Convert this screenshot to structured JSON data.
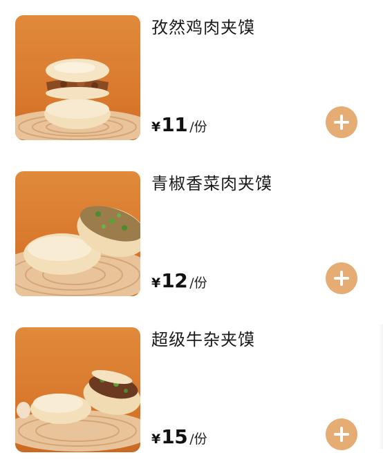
{
  "menu": {
    "items": [
      {
        "name": "孜然鸡肉夹馍",
        "currency": "¥",
        "price": "11",
        "unit": "/份",
        "image_icon": "chicken-roujiamo-photo",
        "add_icon": "plus-icon"
      },
      {
        "name": "青椒香菜肉夹馍",
        "currency": "¥",
        "price": "12",
        "unit": "/份",
        "image_icon": "pepper-cilantro-roujiamo-photo",
        "add_icon": "plus-icon"
      },
      {
        "name": "超级牛杂夹馍",
        "currency": "¥",
        "price": "15",
        "unit": "/份",
        "image_icon": "beef-offal-roujiamo-photo",
        "add_icon": "plus-icon"
      }
    ]
  },
  "colors": {
    "accent": "#e5ac73",
    "photo_background": "#d97a2f",
    "text": "#1a1a1a"
  }
}
